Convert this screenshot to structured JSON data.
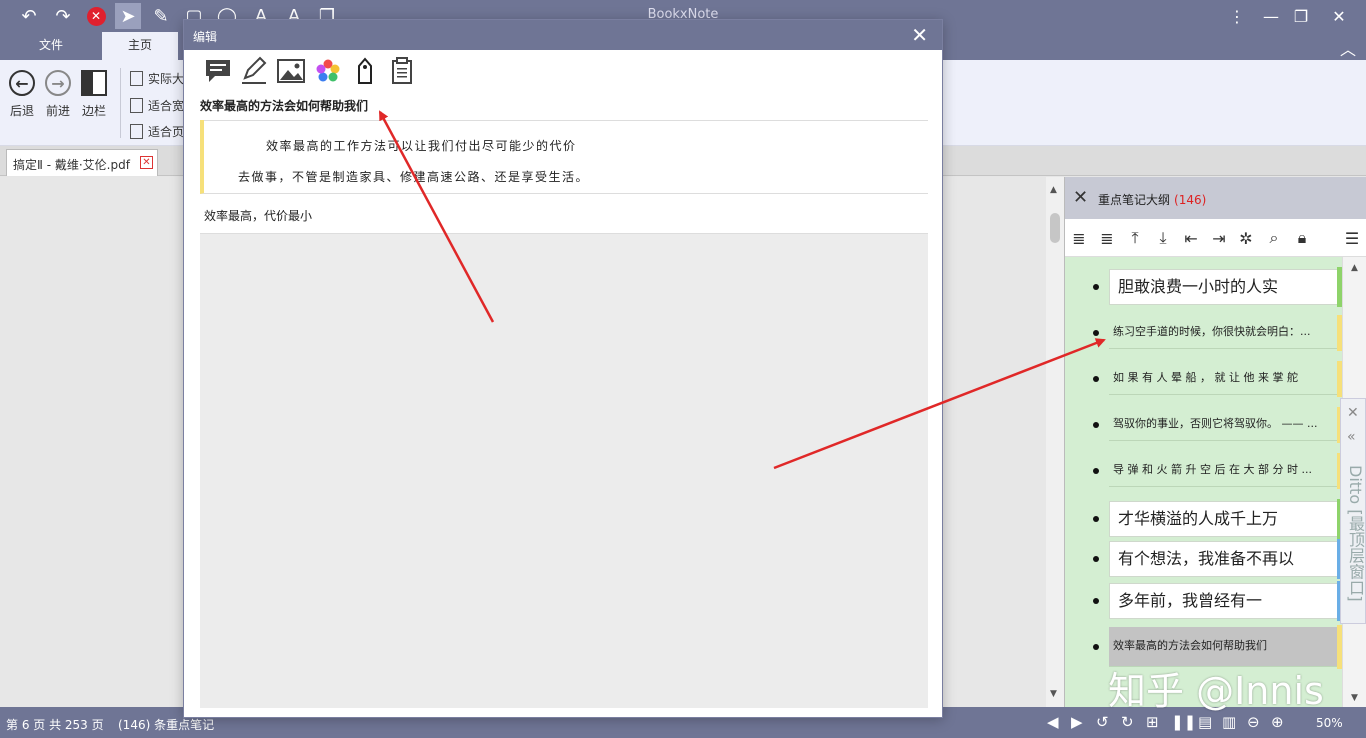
{
  "app": {
    "title": "BookxNote"
  },
  "ribbon": {
    "tabs": [
      "文件",
      "主页"
    ],
    "back_label": "后退",
    "forward_label": "前进",
    "sidebar_label": "边栏",
    "items": [
      "实际大",
      "适合宽",
      "适合页"
    ]
  },
  "document": {
    "tab_label": "搞定Ⅱ - 戴维·艾伦.pdf"
  },
  "dialog": {
    "title": "编辑",
    "note_title": "效率最高的方法会如何帮助我们",
    "quote_line1": "效率最高的工作方法可以让我们付出尽可能少的代价",
    "quote_line2": "去做事，不管是制造家具、修建高速公路、还是享受生活。",
    "note_text": "效率最高，代价最小"
  },
  "outline": {
    "title": "重点笔记大纲",
    "count": "(146)",
    "items": [
      {
        "text": "胆敢浪费一小时的人实",
        "style": "big",
        "stripe": "#8ed36a"
      },
      {
        "text": "练习空手道的时候，你很快就会明白：...",
        "style": "small",
        "stripe": "#f6e07a"
      },
      {
        "text": "如 果 有 人 晕 船 ， 就 让 他 来 掌 舵",
        "style": "small",
        "stripe": "#f6e07a"
      },
      {
        "text": "驾驭你的事业，否则它将驾驭你。 —— ...",
        "style": "small",
        "stripe": "#f6e07a"
      },
      {
        "text": "导 弹 和 火 箭 升 空 后 在 大 部 分 时 ...",
        "style": "small",
        "stripe": "#f6e07a"
      },
      {
        "text": "才华横溢的人成千上万",
        "style": "big",
        "stripe": "#8ed36a"
      },
      {
        "text": "有个想法，我准备不再以",
        "style": "big",
        "stripe": "#6aaee6"
      },
      {
        "text": "多年前，我曾经有一",
        "style": "big",
        "stripe": "#6aaee6"
      },
      {
        "text": "效率最高的方法会如何帮助我们",
        "style": "small sel",
        "stripe": "#f6e07a"
      }
    ]
  },
  "ditto": {
    "label": "Ditto [最顶层窗口]"
  },
  "status": {
    "page_info": "第 6 页 共 253 页",
    "notes_info": "(146) 条重点笔记",
    "zoom": "50%"
  },
  "watermark": "知乎 @Innis",
  "colors": {
    "chrome": "#6f7595",
    "outline_bg": "#d4eed2",
    "arrow": "#e02828"
  }
}
